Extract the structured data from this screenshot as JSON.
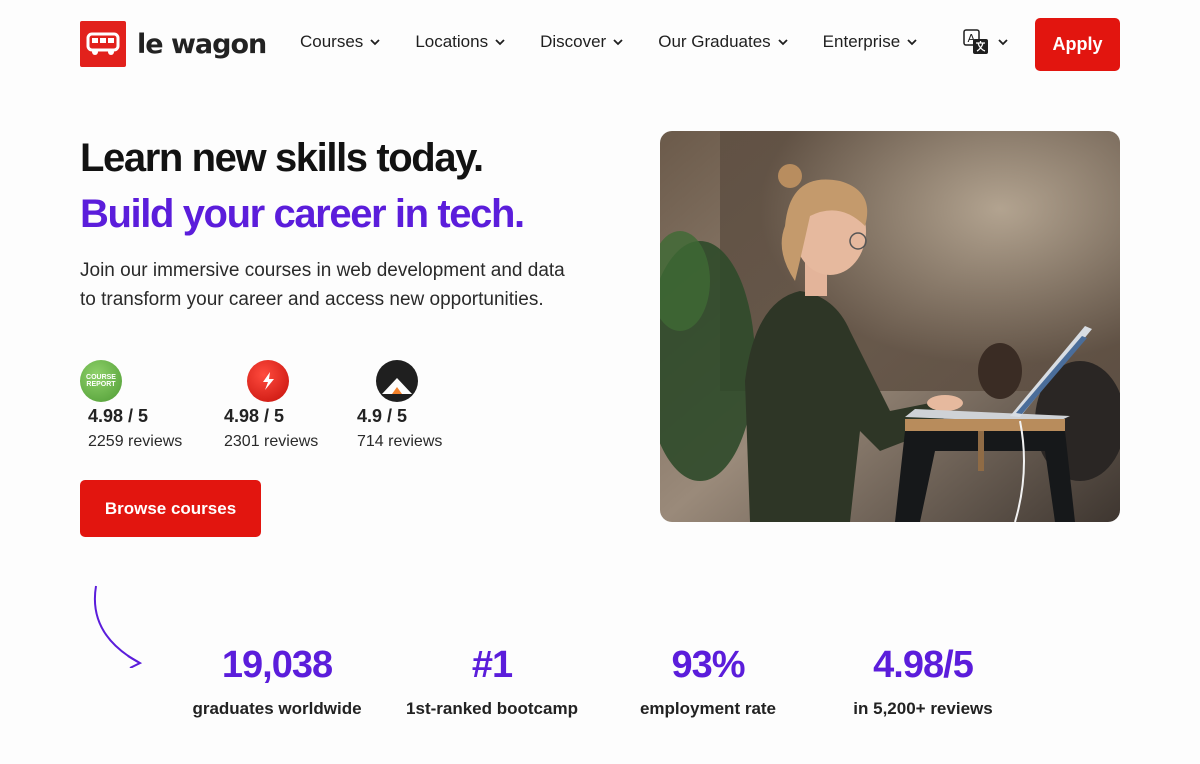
{
  "brand": {
    "name": "le wagon"
  },
  "nav": {
    "items": [
      {
        "label": "Courses"
      },
      {
        "label": "Locations"
      },
      {
        "label": "Discover"
      },
      {
        "label": "Our Graduates"
      },
      {
        "label": "Enterprise"
      }
    ],
    "apply_label": "Apply"
  },
  "hero": {
    "headline": "Learn new skills today.",
    "subheadline": "Build your career in tech.",
    "description": "Join our immersive courses in web development and data to transform your career and access new opportunities.",
    "browse_label": "Browse courses"
  },
  "ratings": [
    {
      "score": "4.98 / 5",
      "count": "2259 reviews",
      "badge_text": "COURSE REPORT"
    },
    {
      "score": "4.98 / 5",
      "count": "2301 reviews"
    },
    {
      "score": "4.9 / 5",
      "count": "714 reviews"
    }
  ],
  "stats": [
    {
      "value": "19,038",
      "label": "graduates worldwide"
    },
    {
      "value": "#1",
      "label": "1st-ranked bootcamp"
    },
    {
      "value": "93%",
      "label": "employment rate"
    },
    {
      "value": "4.98/5",
      "label": "in 5,200+ reviews"
    }
  ],
  "colors": {
    "brand_red": "#e2150f",
    "accent_purple": "#5b1ddb"
  },
  "icons": [
    "bus-logo-icon",
    "chevron-down-icon",
    "translate-icon",
    "course-report-badge-icon",
    "switchup-badge-icon",
    "career-karma-badge-icon",
    "curved-arrow-icon"
  ]
}
